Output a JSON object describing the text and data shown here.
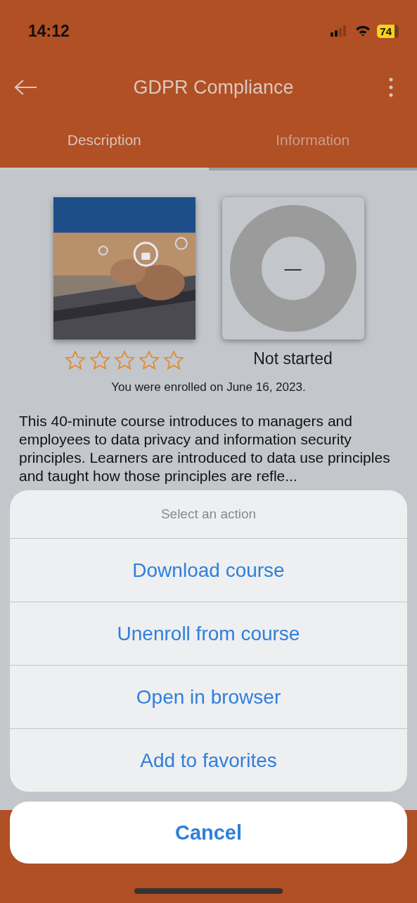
{
  "status_bar": {
    "time": "14:12",
    "battery": "74"
  },
  "header": {
    "title": "GDPR Compliance"
  },
  "tabs": [
    {
      "label": "Description",
      "selected": true
    },
    {
      "label": "Information",
      "selected": false
    }
  ],
  "course": {
    "stars": 0,
    "progress_value": "—",
    "status": "Not started",
    "enrolled": "You were enrolled on June 16, 2023.",
    "description": "This 40-minute course introduces to managers and employees to data privacy and information security principles. Learners are introduced to data use principles and taught how those principles are refle..."
  },
  "action_sheet": {
    "title": "Select an action",
    "actions": [
      "Download course",
      "Unenroll from course",
      "Open in browser",
      "Add to favorites"
    ],
    "cancel": "Cancel"
  }
}
